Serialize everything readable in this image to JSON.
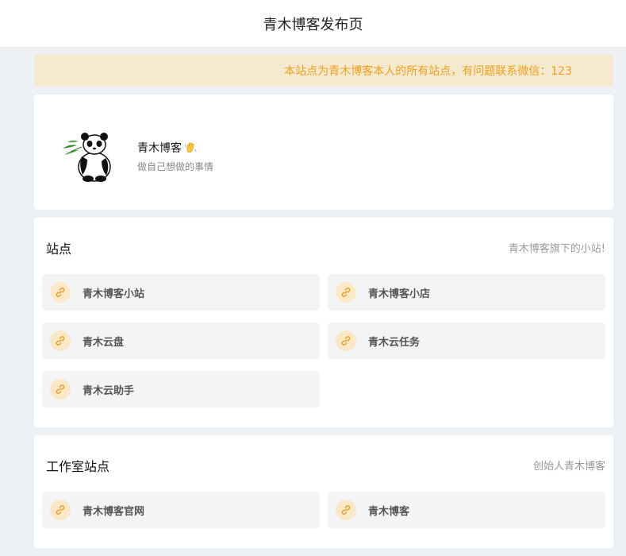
{
  "header": {
    "title": "青木博客发布页"
  },
  "notice": {
    "text": "本站点为青木博客本人的所有站点，有问题联系微信：123"
  },
  "profile": {
    "name": "青木博客",
    "motto": "做自己想做的事情"
  },
  "sites": {
    "title": "站点",
    "note": "青木博客旗下的小站!",
    "items": [
      {
        "label": "青木博客小站"
      },
      {
        "label": "青木博客小店"
      },
      {
        "label": "青木云盘"
      },
      {
        "label": "青木云任务"
      },
      {
        "label": "青木云助手"
      }
    ]
  },
  "studio": {
    "title": "工作室站点",
    "note": "创始人青木博客",
    "items": [
      {
        "label": "青木博客官网"
      },
      {
        "label": "青木博客"
      }
    ]
  },
  "colors": {
    "accent": "#f0a01a",
    "notice_bg": "#f5e9cf",
    "tile_bg": "#f3f4f6",
    "page_bg": "#eef1f4"
  },
  "icons": {
    "tile": "link-icon",
    "greeting": "waving-hand-icon",
    "avatar": "panda-icon"
  }
}
